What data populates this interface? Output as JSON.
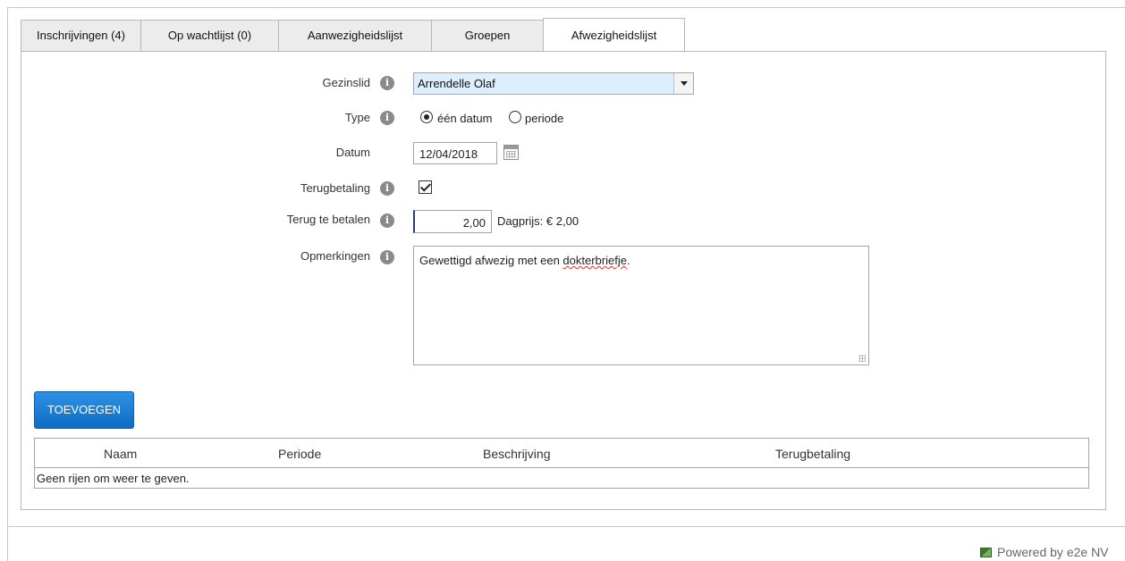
{
  "tabs": [
    {
      "label": "Inschrijvingen (4)"
    },
    {
      "label": "Op wachtlijst (0)"
    },
    {
      "label": "Aanwezigheidslijst"
    },
    {
      "label": "Groepen"
    },
    {
      "label": "Afwezigheidslijst",
      "active": true
    }
  ],
  "form": {
    "member_label": "Gezinslid",
    "member_value": "Arrendelle Olaf",
    "type_label": "Type",
    "type_option_single": "één datum",
    "type_option_period": "periode",
    "type_selected": "één datum",
    "date_label": "Datum",
    "date_value": "12/04/2018",
    "refund_label": "Terugbetaling",
    "refund_checked": true,
    "amount_label": "Terug te betalen",
    "amount_value": "2,00",
    "day_price": "Dagprijs: € 2,00",
    "remarks_label": "Opmerkingen",
    "remarks_text_plain": "Gewettigd afwezig met een ",
    "remarks_text_flagged": "dokterbriefje",
    "remarks_text_end": "."
  },
  "add_button_label": "TOEVOEGEN",
  "table": {
    "columns": [
      "Naam",
      "Periode",
      "Beschrijving",
      "Terugbetaling"
    ],
    "empty_text": "Geen rijen om weer te geven."
  },
  "footer": {
    "powered_by": "Powered by e2e NV"
  },
  "colors": {
    "button_blue": "#1a7ed4",
    "select_bg": "#ddeeff",
    "tab_bg": "#ececec"
  }
}
